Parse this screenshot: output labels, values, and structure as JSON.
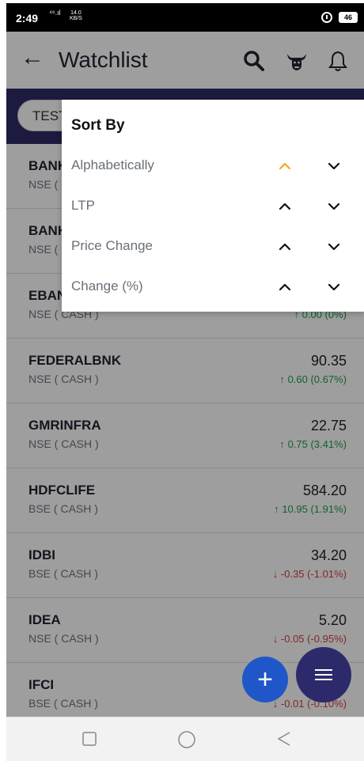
{
  "status_bar": {
    "time": "2:49",
    "signal": "⁴⁶.ıl",
    "net_speed": "14.0",
    "net_unit": "KB/S",
    "battery": "46"
  },
  "header": {
    "title": "Watchlist",
    "icons": [
      "back-arrow-icon",
      "search-icon",
      "bull-icon",
      "bell-icon"
    ]
  },
  "tab": {
    "label": "TEST"
  },
  "sort_popup": {
    "title": "Sort By",
    "options": [
      {
        "label": "Alphabetically",
        "asc_active": true
      },
      {
        "label": "LTP",
        "asc_active": false
      },
      {
        "label": "Price Change",
        "asc_active": false
      },
      {
        "label": "Change (%)",
        "asc_active": false
      }
    ],
    "active_color": "#f5a623"
  },
  "rows": [
    {
      "symbol": "BANK",
      "exchange": "NSE ( CASH )",
      "ltp": "",
      "change": "",
      "dir": "up"
    },
    {
      "symbol": "BANK",
      "exchange": "NSE ( CASH )",
      "ltp": "",
      "change": "",
      "dir": "up"
    },
    {
      "symbol": "EBANK",
      "exchange": "NSE ( CASH )",
      "ltp": "",
      "change": "0.00 (0%)",
      "dir": "up"
    },
    {
      "symbol": "FEDERALBNK",
      "exchange": "NSE ( CASH )",
      "ltp": "90.35",
      "change": "0.60 (0.67%)",
      "dir": "up"
    },
    {
      "symbol": "GMRINFRA",
      "exchange": "NSE ( CASH )",
      "ltp": "22.75",
      "change": "0.75 (3.41%)",
      "dir": "up"
    },
    {
      "symbol": "HDFCLIFE",
      "exchange": "BSE ( CASH )",
      "ltp": "584.20",
      "change": "10.95 (1.91%)",
      "dir": "up"
    },
    {
      "symbol": "IDBI",
      "exchange": "BSE ( CASH )",
      "ltp": "34.20",
      "change": "-0.35 (-1.01%)",
      "dir": "down"
    },
    {
      "symbol": "IDEA",
      "exchange": "NSE ( CASH )",
      "ltp": "5.20",
      "change": "-0.05 (-0.95%)",
      "dir": "down"
    },
    {
      "symbol": "IFCI",
      "exchange": "BSE ( CASH )",
      "ltp": "",
      "change": "-0.01 (-0.10%)",
      "dir": "down"
    }
  ],
  "fabs": {
    "add": "+",
    "menu": "menu-icon"
  },
  "colors": {
    "header_band": "#2f2b67",
    "up": "#1f9b4d",
    "down": "#d93c3c",
    "fab_add": "#1f57c8",
    "fab_menu": "#2d2a6b"
  }
}
